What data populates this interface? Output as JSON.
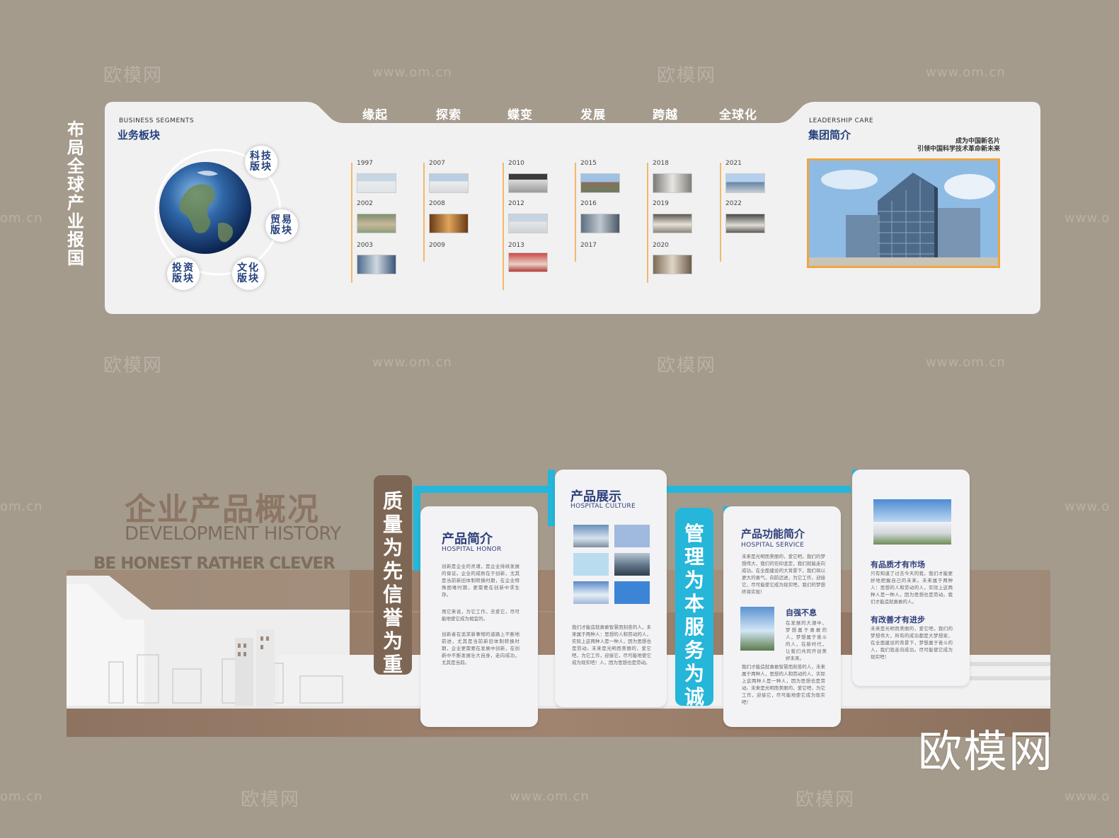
{
  "watermark": {
    "brand": "欧模网",
    "url": "www.om.cn",
    "url_fragment": "om.cn",
    "url_prefix": "www.o"
  },
  "top": {
    "vertical_title": "布局全球 产业报国",
    "business": {
      "en": "BUSINESS SEGMENTS",
      "cn": "业务板块",
      "bubbles": [
        "科技版块",
        "贸易版块",
        "投资版块",
        "文化版块"
      ]
    },
    "eras": [
      "缘起",
      "探索",
      "蝶变",
      "发展",
      "跨越",
      "全球化"
    ],
    "timeline": [
      {
        "years": [
          "1997",
          "2002",
          "2003"
        ]
      },
      {
        "years": [
          "2007",
          "2008",
          "2009"
        ]
      },
      {
        "years": [
          "2010",
          "2012",
          "2013"
        ]
      },
      {
        "years": [
          "2015",
          "2016",
          "2017"
        ]
      },
      {
        "years": [
          "2018",
          "2019",
          "2020"
        ]
      },
      {
        "years": [
          "2021",
          "2022"
        ]
      }
    ],
    "leadership": {
      "en": "LEADERSHIP CARE",
      "cn": "集团简介",
      "slogan1": "成为中国新名片",
      "slogan2": "引领中国科学技术革命新未来"
    }
  },
  "bottom": {
    "title_cn": "企业产品概况",
    "title_en": "DEVELOPMENT HISTORY",
    "slogan_en": "BE HONEST RATHER CLEVER",
    "strip_left": "质量为先 信誉为重",
    "strip_right": "管理为本 服务为诚",
    "card1": {
      "title": "产品简介",
      "sub": "HOSPITAL HONOR",
      "p1": "创新是企业的灵魂，是企业持续发展的保证。企业的成败在于创新，尤其是当前新旧体制转换时期，在企业特殊困难时期，更需要在创新中求生存。",
      "p2": "用它来说，为它工作，去爱它，尽可能地使它成为相宜的。",
      "p3": "创新者在追求新事物的道路上不断地前进，尤其是当前新旧体制转换时期，企业更需要在发展中创新，在创新中不断发展壮大自身，走向成功，尤其是当前。"
    },
    "card2": {
      "title": "产品展示",
      "sub": "HOSPITAL CULTURE",
      "p1": "我们才能造就勇敢智慧而刻苦的人，未来属于两种人：思想的人和劳动的人，实际上这两种人是一种人，因为思想也是劳动。未来是光明而美丽的，爱它吧，为它工作，迎接它，尽可能地使它成为现实吧！人，因为思想也是劳动。"
    },
    "card3": {
      "title": "产品功能简介",
      "sub": "HOSPITAL SERVICE",
      "p1": "未来是光明而美丽的，爱它吧，我们的梦想伟大，我们的信仰坚定，我们就能走向成功。在全面建设的大背景下，我们将以更大的勇气，向前迈进，为它工作，迎接它，尽可能使它成为现实吧，我们的梦想终将实现！",
      "sub_h": "自强不息",
      "p2": "在发展的大潮中，梦想属于勇敢的人，梦想属于奋斗的人，在新时代，让我们共同开创美好未来。",
      "p3": "我们才能造就勇敢智慧而刻苦的人，未来属于两种人，思想的人和劳动的人，实际上这两种人是一种人，因为思想也是劳动。未来是光明而美丽的，爱它吧，为它工作，迎接它，尽可能地使它成为现实吧！"
    },
    "card4": {
      "h1": "有品质才有市场",
      "p1": "只有知道了过去今天的我，我们才能更好地把握自己的未来。未来属于两种人：思想的人和劳动的人，实际上这两种人是一种人，因为思想也是劳动。我们才能造就勇敢的人。",
      "h2": "有改善才有进步",
      "p2": "未来是光明而美丽的，爱它吧，我们的梦想伟大，所有的成功都是大梦想家，在全面建设的背景下，梦想属于奋斗的人，我们就走向成功。尽可能使它成为现实吧！"
    }
  }
}
